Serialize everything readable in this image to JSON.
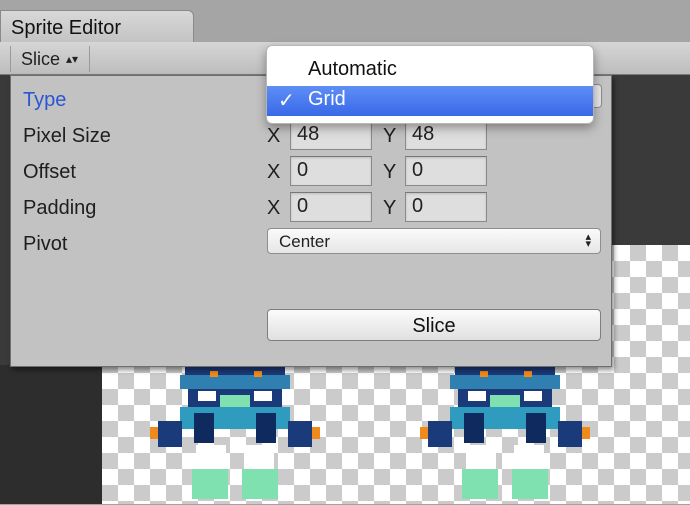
{
  "window": {
    "tab_title": "Sprite Editor"
  },
  "toolbar": {
    "slice_menu_label": "Slice",
    "slice_menu_arrows": "⇕"
  },
  "slice_panel": {
    "type_label": "Type",
    "pixel_size": {
      "label": "Pixel Size",
      "x_label": "X",
      "x_value": "48",
      "y_label": "Y",
      "y_value": "48"
    },
    "offset": {
      "label": "Offset",
      "x_label": "X",
      "x_value": "0",
      "y_label": "Y",
      "y_value": "0"
    },
    "padding": {
      "label": "Padding",
      "x_label": "X",
      "x_value": "0",
      "y_label": "Y",
      "y_value": "0"
    },
    "pivot": {
      "label": "Pivot",
      "selected": "Center",
      "arrows": "▴▾"
    },
    "slice_button_label": "Slice"
  },
  "type_dropdown": {
    "options": [
      {
        "label": "Automatic",
        "selected": false
      },
      {
        "label": "Grid",
        "selected": true,
        "check": "✓"
      }
    ],
    "highlight_color": "#3f71ea"
  },
  "colors": {
    "type_label": "#2a56d6",
    "sprite_dark_blue": "#1b3a7a",
    "sprite_teal": "#2f9bbf",
    "sprite_orange": "#f08a1a",
    "sprite_green": "#7fe0b0"
  }
}
